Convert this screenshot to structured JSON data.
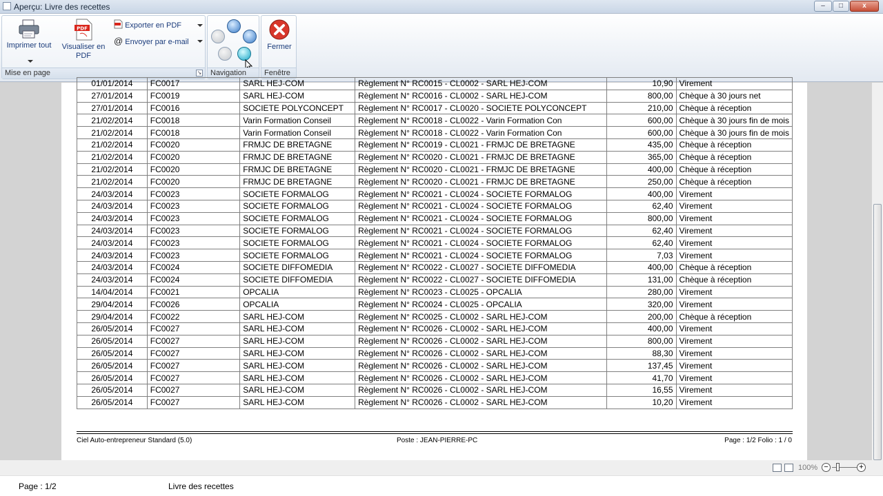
{
  "window": {
    "title": "Aperçu: Livre des recettes",
    "controls": [
      "–",
      "□",
      "x"
    ]
  },
  "ribbon": {
    "mise_en_page": {
      "label": "Mise en page",
      "imprimer": "Imprimer tout",
      "visualiser_l1": "Visualiser en",
      "visualiser_l2": "PDF",
      "exporter": "Exporter en PDF",
      "envoyer": "Envoyer par e-mail"
    },
    "navigation": {
      "label": "Navigation"
    },
    "fenetre": {
      "label": "Fenêtre",
      "fermer": "Fermer"
    }
  },
  "partial_row": {
    "date": "01/01/2014",
    "piece": "FC0017",
    "tiers": "SARL HEJ-COM",
    "libelle": "Règlement N° RC0015 - CL0002 - SARL HEJ-COM",
    "montant": "10,90",
    "mode": "Virement"
  },
  "rows": [
    [
      "01/01/2014",
      "FC0017",
      "SARL HEJ-COM",
      "Règlement N° RC0015 - CL0002 - SARL HEJ-COM",
      "10,90",
      "Virement"
    ],
    [
      "27/01/2014",
      "FC0019",
      "SARL HEJ-COM",
      "Règlement N° RC0016 - CL0002 - SARL HEJ-COM",
      "800,00",
      "Chèque à 30 jours net"
    ],
    [
      "27/01/2014",
      "FC0016",
      "SOCIETE POLYCONCEPT",
      "Règlement N° RC0017 - CL0020 - SOCIETE POLYCONCEPT",
      "210,00",
      "Chèque à réception"
    ],
    [
      "21/02/2014",
      "FC0018",
      "Varin Formation Conseil",
      "Règlement N° RC0018 - CL0022 - Varin Formation Con",
      "600,00",
      "Chèque à 30 jours fin de mois"
    ],
    [
      "21/02/2014",
      "FC0018",
      "Varin Formation Conseil",
      "Règlement N° RC0018 - CL0022 - Varin Formation Con",
      "600,00",
      "Chèque à 30 jours fin de mois"
    ],
    [
      "21/02/2014",
      "FC0020",
      "FRMJC DE BRETAGNE",
      "Règlement N° RC0019 - CL0021 - FRMJC DE BRETAGNE",
      "435,00",
      "Chèque à réception"
    ],
    [
      "21/02/2014",
      "FC0020",
      "FRMJC DE BRETAGNE",
      "Règlement N° RC0020 - CL0021 - FRMJC DE BRETAGNE",
      "365,00",
      "Chèque à réception"
    ],
    [
      "21/02/2014",
      "FC0020",
      "FRMJC DE BRETAGNE",
      "Règlement N° RC0020 - CL0021 - FRMJC DE BRETAGNE",
      "400,00",
      "Chèque à réception"
    ],
    [
      "21/02/2014",
      "FC0020",
      "FRMJC DE BRETAGNE",
      "Règlement N° RC0020 - CL0021 - FRMJC DE BRETAGNE",
      "250,00",
      "Chèque à réception"
    ],
    [
      "24/03/2014",
      "FC0023",
      "SOCIETE FORMALOG",
      "Règlement N° RC0021 - CL0024 - SOCIETE FORMALOG",
      "400,00",
      "Virement"
    ],
    [
      "24/03/2014",
      "FC0023",
      "SOCIETE FORMALOG",
      "Règlement N° RC0021 - CL0024 - SOCIETE FORMALOG",
      "62,40",
      "Virement"
    ],
    [
      "24/03/2014",
      "FC0023",
      "SOCIETE FORMALOG",
      "Règlement N° RC0021 - CL0024 - SOCIETE FORMALOG",
      "800,00",
      "Virement"
    ],
    [
      "24/03/2014",
      "FC0023",
      "SOCIETE FORMALOG",
      "Règlement N° RC0021 - CL0024 - SOCIETE FORMALOG",
      "62,40",
      "Virement"
    ],
    [
      "24/03/2014",
      "FC0023",
      "SOCIETE FORMALOG",
      "Règlement N° RC0021 - CL0024 - SOCIETE FORMALOG",
      "62,40",
      "Virement"
    ],
    [
      "24/03/2014",
      "FC0023",
      "SOCIETE FORMALOG",
      "Règlement N° RC0021 - CL0024 - SOCIETE FORMALOG",
      "7,03",
      "Virement"
    ],
    [
      "24/03/2014",
      "FC0024",
      "SOCIETE DIFFOMEDIA",
      "Règlement N° RC0022 - CL0027 - SOCIETE DIFFOMEDIA",
      "400,00",
      "Chèque à réception"
    ],
    [
      "24/03/2014",
      "FC0024",
      "SOCIETE DIFFOMEDIA",
      "Règlement N° RC0022 - CL0027 - SOCIETE DIFFOMEDIA",
      "131,00",
      "Chèque à réception"
    ],
    [
      "14/04/2014",
      "FC0021",
      "OPCALIA",
      "Règlement N° RC0023 - CL0025 - OPCALIA",
      "280,00",
      "Virement"
    ],
    [
      "29/04/2014",
      "FC0026",
      "OPCALIA",
      "Règlement N° RC0024 - CL0025 - OPCALIA",
      "320,00",
      "Virement"
    ],
    [
      "29/04/2014",
      "FC0022",
      "SARL HEJ-COM",
      "Règlement N° RC0025 - CL0002 - SARL HEJ-COM",
      "200,00",
      "Chèque à réception"
    ],
    [
      "26/05/2014",
      "FC0027",
      "SARL HEJ-COM",
      "Règlement N° RC0026 - CL0002 - SARL HEJ-COM",
      "400,00",
      "Virement"
    ],
    [
      "26/05/2014",
      "FC0027",
      "SARL HEJ-COM",
      "Règlement N° RC0026 - CL0002 - SARL HEJ-COM",
      "800,00",
      "Virement"
    ],
    [
      "26/05/2014",
      "FC0027",
      "SARL HEJ-COM",
      "Règlement N° RC0026 - CL0002 - SARL HEJ-COM",
      "88,30",
      "Virement"
    ],
    [
      "26/05/2014",
      "FC0027",
      "SARL HEJ-COM",
      "Règlement N° RC0026 - CL0002 - SARL HEJ-COM",
      "137,45",
      "Virement"
    ],
    [
      "26/05/2014",
      "FC0027",
      "SARL HEJ-COM",
      "Règlement N° RC0026 - CL0002 - SARL HEJ-COM",
      "41,70",
      "Virement"
    ],
    [
      "26/05/2014",
      "FC0027",
      "SARL HEJ-COM",
      "Règlement N° RC0026 - CL0002 - SARL HEJ-COM",
      "16,55",
      "Virement"
    ],
    [
      "26/05/2014",
      "FC0027",
      "SARL HEJ-COM",
      "Règlement N° RC0026 - CL0002 - SARL HEJ-COM",
      "10,20",
      "Virement"
    ]
  ],
  "report_footer": {
    "software": "Ciel Auto-entrepreneur Standard (5.0)",
    "poste": "Poste : JEAN-PIERRE-PC",
    "page": "Page : 1/2 Folio : 1 / 0"
  },
  "zoom": {
    "level": "100%",
    "minus": "−",
    "plus": "+"
  },
  "statusbar": {
    "page": "Page : 1/2",
    "report": "Livre des recettes"
  },
  "colors": {
    "pdf_red": "#d9261c",
    "close_red": "#d8372b",
    "nav_blue": "#3a7cc8",
    "nav_teal": "#1aa7c8"
  },
  "icons": [
    "printer-icon",
    "pdf-icon",
    "export-pdf-icon",
    "email-icon",
    "first-page-icon",
    "zoom-icon",
    "last-page-icon",
    "previous-page-icon",
    "next-page-icon",
    "close-red-icon"
  ]
}
